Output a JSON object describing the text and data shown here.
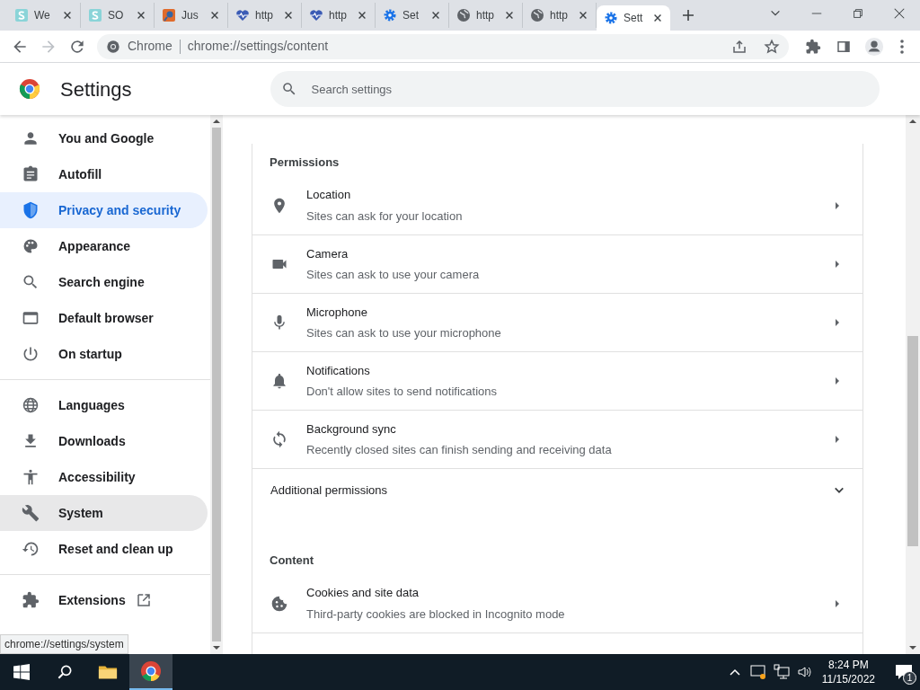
{
  "tabs": [
    {
      "title": "We",
      "selected": false
    },
    {
      "title": "SO",
      "selected": false
    },
    {
      "title": "Jus",
      "selected": false
    },
    {
      "title": "http",
      "selected": false
    },
    {
      "title": "http",
      "selected": false
    },
    {
      "title": "Set",
      "selected": false
    },
    {
      "title": "http",
      "selected": false
    },
    {
      "title": "http",
      "selected": false
    },
    {
      "title": "Sett",
      "selected": true
    }
  ],
  "omnibox": {
    "chip": "Chrome",
    "url": "chrome://settings/content"
  },
  "header": {
    "title": "Settings",
    "search_placeholder": "Search settings"
  },
  "sidebar": {
    "groups": [
      [
        {
          "label": "You and Google",
          "selected": false,
          "hovered": false
        },
        {
          "label": "Autofill",
          "selected": false,
          "hovered": false
        },
        {
          "label": "Privacy and security",
          "selected": true,
          "hovered": false
        },
        {
          "label": "Appearance",
          "selected": false,
          "hovered": false
        },
        {
          "label": "Search engine",
          "selected": false,
          "hovered": false
        },
        {
          "label": "Default browser",
          "selected": false,
          "hovered": false
        },
        {
          "label": "On startup",
          "selected": false,
          "hovered": false
        }
      ],
      [
        {
          "label": "Languages",
          "selected": false,
          "hovered": false
        },
        {
          "label": "Downloads",
          "selected": false,
          "hovered": false
        },
        {
          "label": "Accessibility",
          "selected": false,
          "hovered": false
        },
        {
          "label": "System",
          "selected": false,
          "hovered": true
        },
        {
          "label": "Reset and clean up",
          "selected": false,
          "hovered": false
        }
      ],
      [
        {
          "label": "Extensions",
          "selected": false,
          "hovered": false,
          "external": true
        }
      ]
    ]
  },
  "main": {
    "sections": [
      {
        "heading": "Permissions",
        "rows": [
          {
            "kind": "link",
            "title": "Location",
            "subtitle": "Sites can ask for your location"
          },
          {
            "kind": "link",
            "title": "Camera",
            "subtitle": "Sites can ask to use your camera"
          },
          {
            "kind": "link",
            "title": "Microphone",
            "subtitle": "Sites can ask to use your microphone"
          },
          {
            "kind": "link",
            "title": "Notifications",
            "subtitle": "Don't allow sites to send notifications"
          },
          {
            "kind": "link",
            "title": "Background sync",
            "subtitle": "Recently closed sites can finish sending and receiving data"
          },
          {
            "kind": "expand",
            "title": "Additional permissions",
            "expanded": false
          }
        ]
      },
      {
        "heading": "Content",
        "rows": [
          {
            "kind": "link",
            "title": "Cookies and site data",
            "subtitle": "Third-party cookies are blocked in Incognito mode"
          }
        ]
      }
    ]
  },
  "status_url": "chrome://settings/system",
  "taskbar": {
    "time": "8:24 PM",
    "date": "11/15/2022",
    "notifications": "1"
  }
}
